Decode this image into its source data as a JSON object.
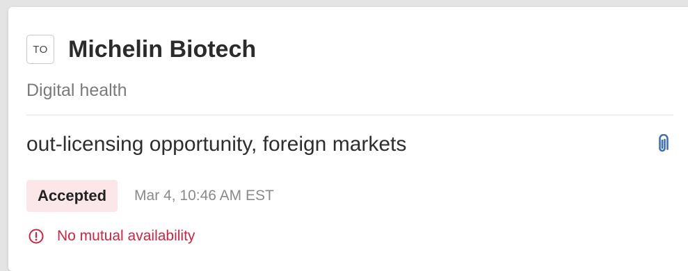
{
  "card": {
    "badge_text": "TO",
    "company": "Michelin Biotech",
    "industry": "Digital health",
    "topic": "out-licensing opportunity, foreign markets",
    "attachment_icon": "paperclip-icon",
    "status": {
      "label": "Accepted",
      "timestamp": "Mar 4, 10:46 AM EST"
    },
    "warning": {
      "icon": "alert-circle-icon",
      "text": "No mutual availability"
    }
  },
  "colors": {
    "status_badge_bg": "#fbe7ea",
    "warning": "#d0233f",
    "attachment_icon": "#3f6fb6"
  }
}
